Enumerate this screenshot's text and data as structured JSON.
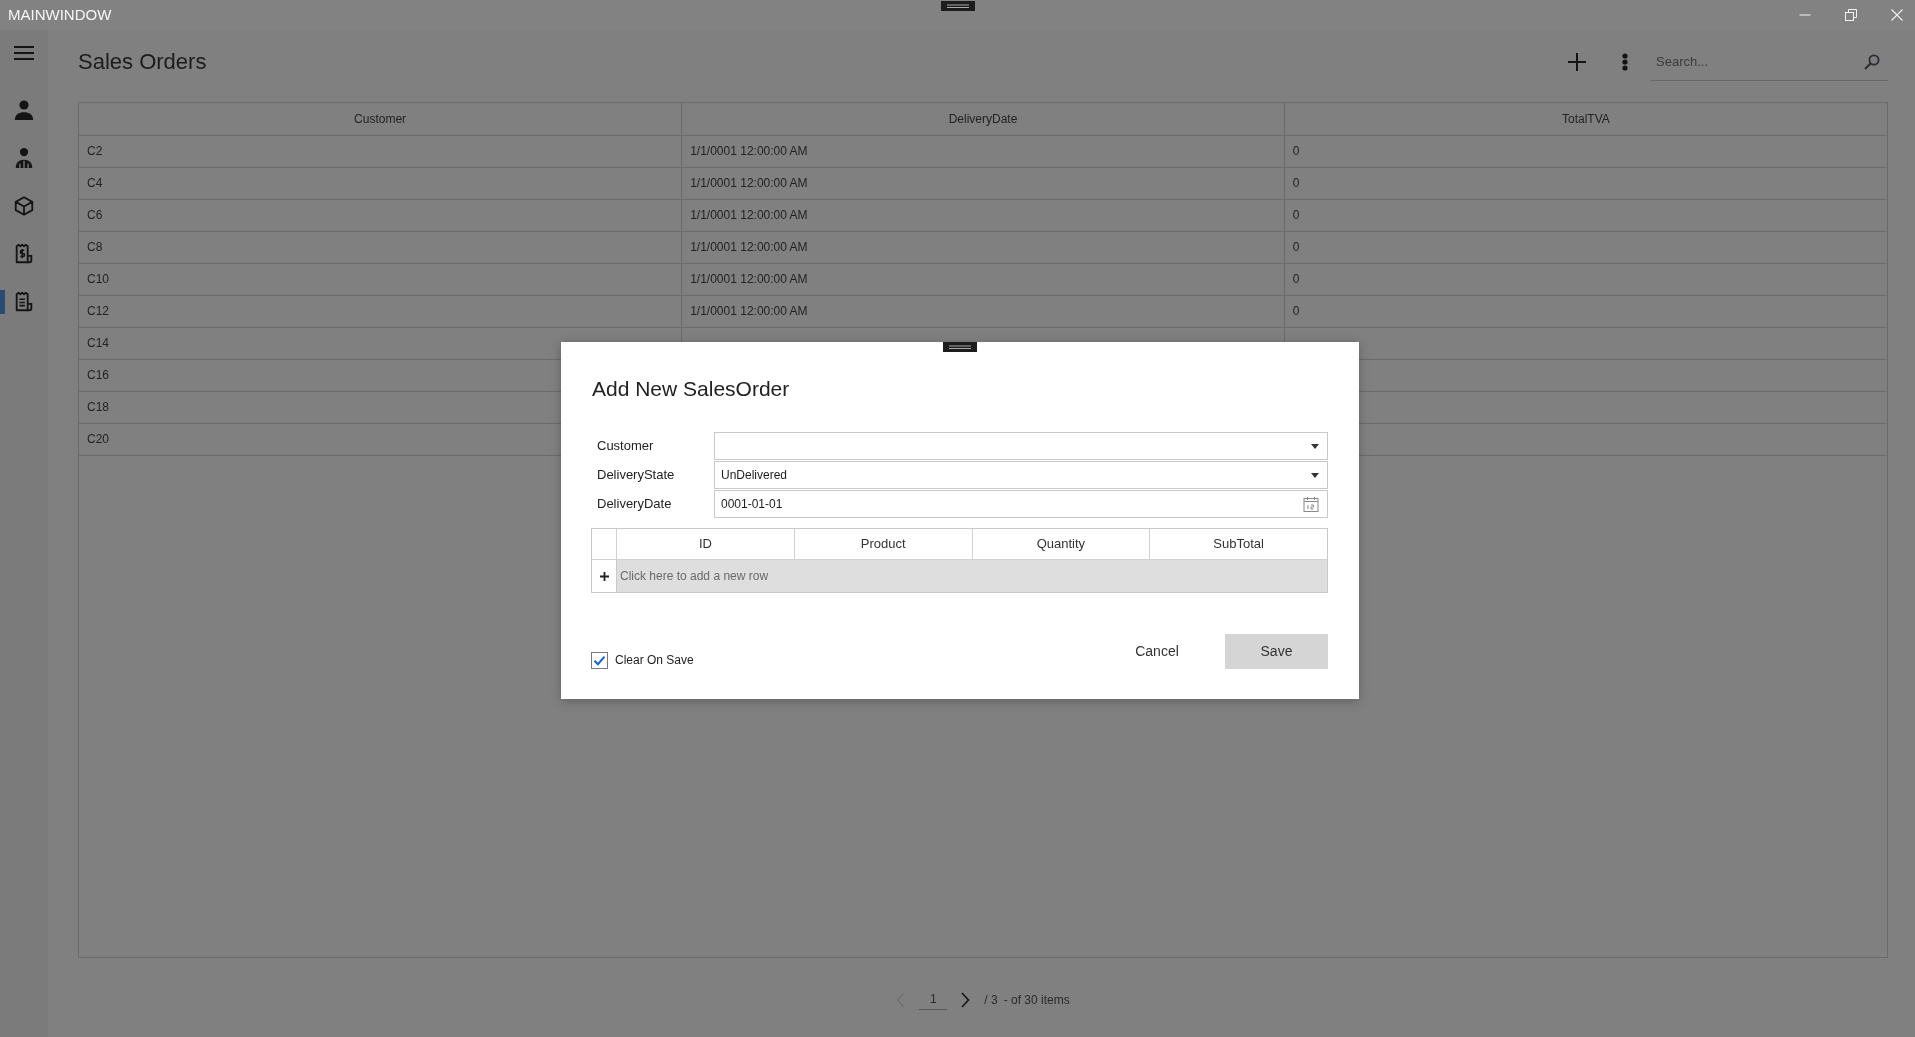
{
  "window": {
    "title": "MAINWINDOW"
  },
  "sidebar": {
    "items": [
      {
        "selected": false
      },
      {
        "selected": false
      },
      {
        "selected": false
      },
      {
        "selected": false
      },
      {
        "selected": true
      }
    ]
  },
  "header": {
    "title": "Sales Orders",
    "search": {
      "placeholder": "Search..."
    }
  },
  "table": {
    "columns": [
      "Customer",
      "DeliveryDate",
      "TotalTVA"
    ],
    "rows": [
      [
        "C2",
        "1/1/0001 12:00:00 AM",
        "0"
      ],
      [
        "C4",
        "1/1/0001 12:00:00 AM",
        "0"
      ],
      [
        "C6",
        "1/1/0001 12:00:00 AM",
        "0"
      ],
      [
        "C8",
        "1/1/0001 12:00:00 AM",
        "0"
      ],
      [
        "C10",
        "1/1/0001 12:00:00 AM",
        "0"
      ],
      [
        "C12",
        "1/1/0001 12:00:00 AM",
        "0"
      ],
      [
        "C14"
      ],
      [
        "C16"
      ],
      [
        "C18"
      ],
      [
        "C20"
      ]
    ]
  },
  "pager": {
    "prev": {
      "disabled": true
    },
    "page": {
      "value": "1"
    },
    "next": {
      "disabled": false
    },
    "page_count": "/ 3",
    "summary": "- of 30 items"
  },
  "dialog": {
    "title": "Add New SalesOrder",
    "fields": [
      {
        "label": "Customer",
        "kind": "dropdown"
      },
      {
        "label": "DeliveryState",
        "kind": "dropdown",
        "value": "UnDelivered"
      },
      {
        "label": "DeliveryDate",
        "kind": "date",
        "value": "0001-01-01"
      }
    ],
    "grid": {
      "columns": [
        "ID",
        "Product",
        "Quantity",
        "SubTotal"
      ],
      "new_row_hint": "Click here to add a new row"
    },
    "clear_on_save": {
      "label": "Clear On Save",
      "checked": true
    },
    "buttons": [
      {
        "label": "Cancel",
        "kind": "text"
      },
      {
        "label": "Save",
        "kind": "filled"
      }
    ]
  }
}
